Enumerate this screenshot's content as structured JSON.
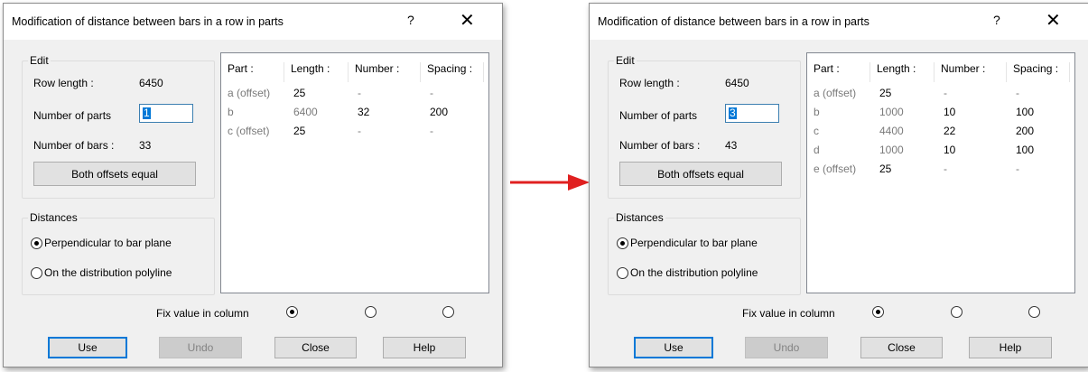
{
  "dialogs": [
    {
      "title": "Modification of distance between bars in a row in parts",
      "help_glyph": "?",
      "close_glyph": "✕",
      "edit": {
        "group_label": "Edit",
        "row_length_label": "Row length :",
        "row_length_value": "6450",
        "number_of_parts_label": "Number of parts",
        "number_of_parts_value": "1",
        "number_of_bars_label": "Number of bars :",
        "number_of_bars_value": "33",
        "both_offsets_label": "Both offsets equal"
      },
      "distances": {
        "group_label": "Distances",
        "options": [
          {
            "label": "Perpendicular to bar plane",
            "selected": true
          },
          {
            "label": "On the distribution polyline",
            "selected": false
          }
        ]
      },
      "table": {
        "headers": [
          "Part :",
          "Length :",
          "Number :",
          "Spacing :"
        ],
        "rows": [
          [
            "a (offset)",
            "25",
            "-",
            "-"
          ],
          [
            "b",
            "6400",
            "32",
            "200"
          ],
          [
            "c (offset)",
            "25",
            "-",
            "-"
          ]
        ]
      },
      "fix_value_label": "Fix value in column",
      "fix_selected_index": 0,
      "buttons": {
        "use": "Use",
        "undo": "Undo",
        "close": "Close",
        "help": "Help"
      }
    },
    {
      "title": "Modification of distance between bars in a row in parts",
      "help_glyph": "?",
      "close_glyph": "✕",
      "edit": {
        "group_label": "Edit",
        "row_length_label": "Row length :",
        "row_length_value": "6450",
        "number_of_parts_label": "Number of parts",
        "number_of_parts_value": "3",
        "number_of_bars_label": "Number of bars :",
        "number_of_bars_value": "43",
        "both_offsets_label": "Both offsets equal"
      },
      "distances": {
        "group_label": "Distances",
        "options": [
          {
            "label": "Perpendicular to bar plane",
            "selected": true
          },
          {
            "label": "On the distribution polyline",
            "selected": false
          }
        ]
      },
      "table": {
        "headers": [
          "Part :",
          "Length :",
          "Number :",
          "Spacing :"
        ],
        "rows": [
          [
            "a (offset)",
            "25",
            "-",
            "-"
          ],
          [
            "b",
            "1000",
            "10",
            "100"
          ],
          [
            "c",
            "4400",
            "22",
            "200"
          ],
          [
            "d",
            "1000",
            "10",
            "100"
          ],
          [
            "e (offset)",
            "25",
            "-",
            "-"
          ]
        ]
      },
      "fix_value_label": "Fix value in column",
      "fix_selected_index": 0,
      "buttons": {
        "use": "Use",
        "undo": "Undo",
        "close": "Close",
        "help": "Help"
      }
    }
  ],
  "colors": {
    "arrow": "#e02020",
    "selection": "#0078d7"
  },
  "icons": {
    "arrow": "right-arrow-icon"
  }
}
